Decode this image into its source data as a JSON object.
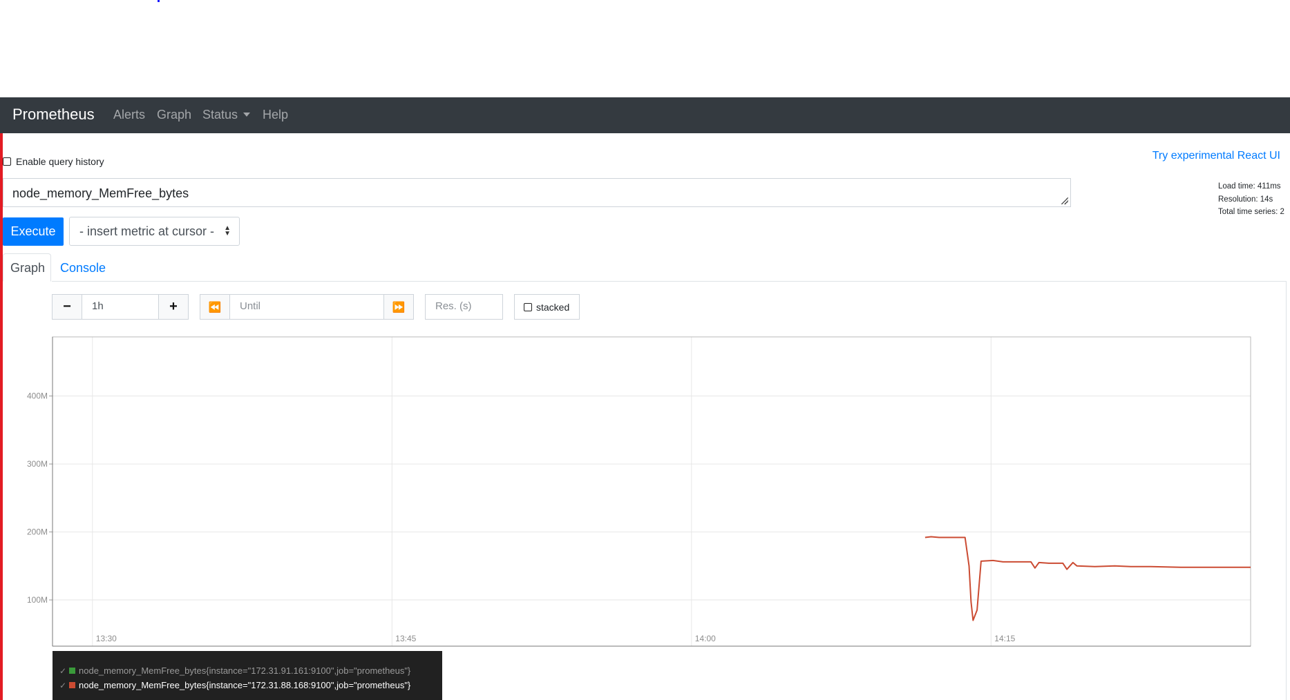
{
  "navbar": {
    "brand": "Prometheus",
    "items": [
      "Alerts",
      "Graph",
      "Status",
      "Help"
    ]
  },
  "query_history_label": "Enable query history",
  "react_link": "Try experimental React UI",
  "stats": {
    "load_time": "Load time: 411ms",
    "resolution": "Resolution: 14s",
    "total_series": "Total time series: 2"
  },
  "query": {
    "expression": "node_memory_MemFree_bytes"
  },
  "execute_label": "Execute",
  "metric_select_label": "- insert metric at cursor -",
  "tabs": {
    "graph": "Graph",
    "console": "Console"
  },
  "controls": {
    "minus": "−",
    "range": "1h",
    "plus": "+",
    "back": "⏪",
    "until_placeholder": "Until",
    "forward": "⏩",
    "resolution_placeholder": "Res. (s)",
    "stacked_label": "stacked"
  },
  "colors": {
    "navbar": "#343a40",
    "accent": "#007bff",
    "series_1": "#3a9a3a",
    "series_2": "#cb4b32",
    "left_bar": "#e31b23"
  },
  "chart_data": {
    "type": "line",
    "y_ticks": [
      "400M",
      "300M",
      "200M",
      "100M"
    ],
    "y_tick_values": [
      400000000,
      300000000,
      200000000,
      100000000
    ],
    "x_ticks": [
      "13:30",
      "13:45",
      "14:00",
      "14:15"
    ],
    "x_tick_minutes": [
      810,
      825,
      840,
      855
    ],
    "x_range": [
      "13:28",
      "14:28"
    ],
    "x_range_minutes": [
      808,
      868
    ],
    "ylim": [
      32000000,
      487000000
    ],
    "grid": true,
    "legend_placement": "bottom-left",
    "series": [
      {
        "name": "node_memory_MemFree_bytes{instance=\"172.31.91.161:9100\",job=\"prometheus\"}",
        "color": "#3a9a3a",
        "visible": false,
        "points": []
      },
      {
        "name": "node_memory_MemFree_bytes{instance=\"172.31.88.168:9100\",job=\"prometheus\"}",
        "color": "#cb4b32",
        "visible": true,
        "points": [
          [
            851.7,
            192000000
          ],
          [
            852.0,
            193000000
          ],
          [
            852.4,
            192000000
          ],
          [
            853.2,
            192000000
          ],
          [
            853.7,
            192000000
          ],
          [
            853.9,
            150000000
          ],
          [
            854.0,
            97000000
          ],
          [
            854.1,
            70000000
          ],
          [
            854.3,
            85000000
          ],
          [
            854.5,
            157000000
          ],
          [
            855.1,
            158000000
          ],
          [
            855.6,
            156000000
          ],
          [
            856.6,
            156000000
          ],
          [
            857.0,
            156000000
          ],
          [
            857.2,
            147000000
          ],
          [
            857.4,
            155000000
          ],
          [
            857.9,
            154000000
          ],
          [
            858.6,
            154000000
          ],
          [
            858.8,
            145000000
          ],
          [
            859.1,
            155000000
          ],
          [
            859.3,
            150000000
          ],
          [
            860.2,
            149000000
          ],
          [
            861.2,
            150000000
          ],
          [
            862.0,
            149000000
          ],
          [
            863.0,
            149000000
          ],
          [
            864.5,
            148000000
          ],
          [
            866.0,
            148000000
          ],
          [
            868.0,
            148000000
          ]
        ]
      }
    ]
  }
}
